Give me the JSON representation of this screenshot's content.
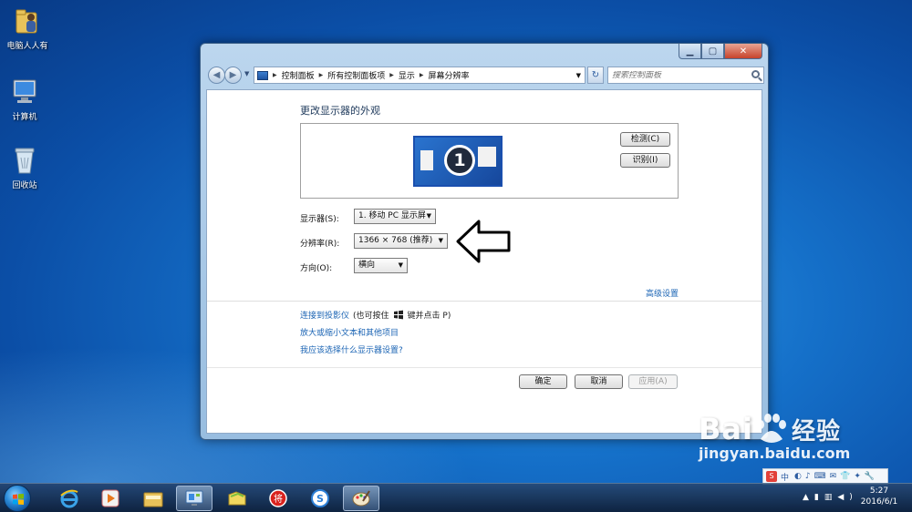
{
  "desktop": {
    "icons": [
      {
        "label": "电脑人人有"
      },
      {
        "label": "计算机"
      },
      {
        "label": "回收站"
      }
    ]
  },
  "window": {
    "controls": {
      "minimize": "▁",
      "maximize": "▢",
      "close": "✕"
    },
    "breadcrumbs": [
      "控制面板",
      "所有控制面板项",
      "显示",
      "屏幕分辨率"
    ],
    "search_placeholder": "搜索控制面板",
    "heading": "更改显示器的外观",
    "monitor_number": "1",
    "detect_button": "检测(C)",
    "identify_button": "识别(I)",
    "display_label": "显示器(S):",
    "display_value": "1. 移动 PC 显示屏",
    "resolution_label": "分辨率(R):",
    "resolution_value": "1366 × 768 (推荐)",
    "orientation_label": "方向(O):",
    "orientation_value": "横向",
    "advanced_link": "高级设置",
    "projector_link": "连接到投影仪",
    "projector_hint_pre": "(也可按住",
    "projector_hint_post": "键并点击 P)",
    "text_size_link": "放大或缩小文本和其他项目",
    "which_settings_link": "我应该选择什么显示器设置?",
    "ok_button": "确定",
    "cancel_button": "取消",
    "apply_button": "应用(A)"
  },
  "taskbar": {
    "clock_time": "5:27",
    "clock_date": "2016/6/1",
    "tray_ime": "中"
  },
  "watermark": {
    "brand": "Bai",
    "brand_cn": "经验",
    "site": "jingyan.baidu.com"
  },
  "colors": {
    "link": "#1b64b4",
    "heading": "#1e395b",
    "desktop": "#1570c9"
  }
}
